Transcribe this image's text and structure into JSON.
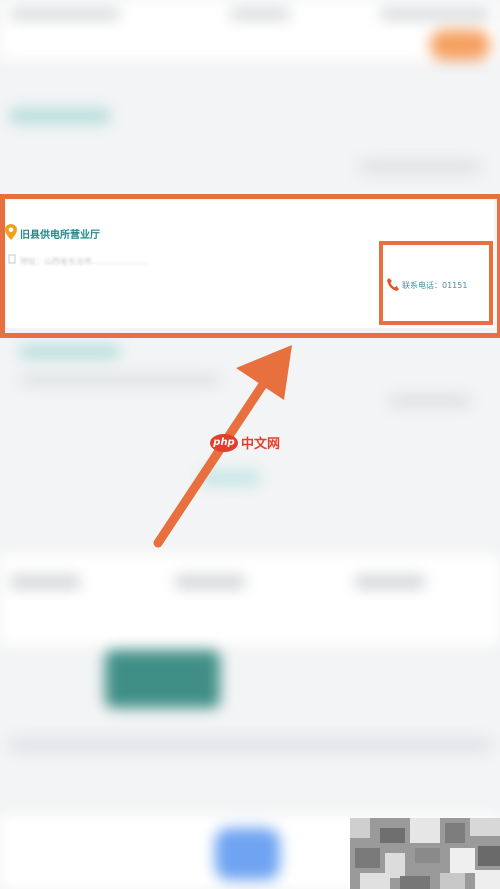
{
  "card": {
    "title": "旧县供电所营业厅",
    "address": "地址：山西省长治市…………………",
    "phone": "联系电话：01151"
  },
  "watermark": {
    "badge": "php",
    "text": "中文网"
  },
  "colors": {
    "highlight": "#e8703f",
    "title": "#1e8a88",
    "pin": "#f0a020",
    "phone_icon": "#e05a2a",
    "watermark": "#e33d2b"
  }
}
